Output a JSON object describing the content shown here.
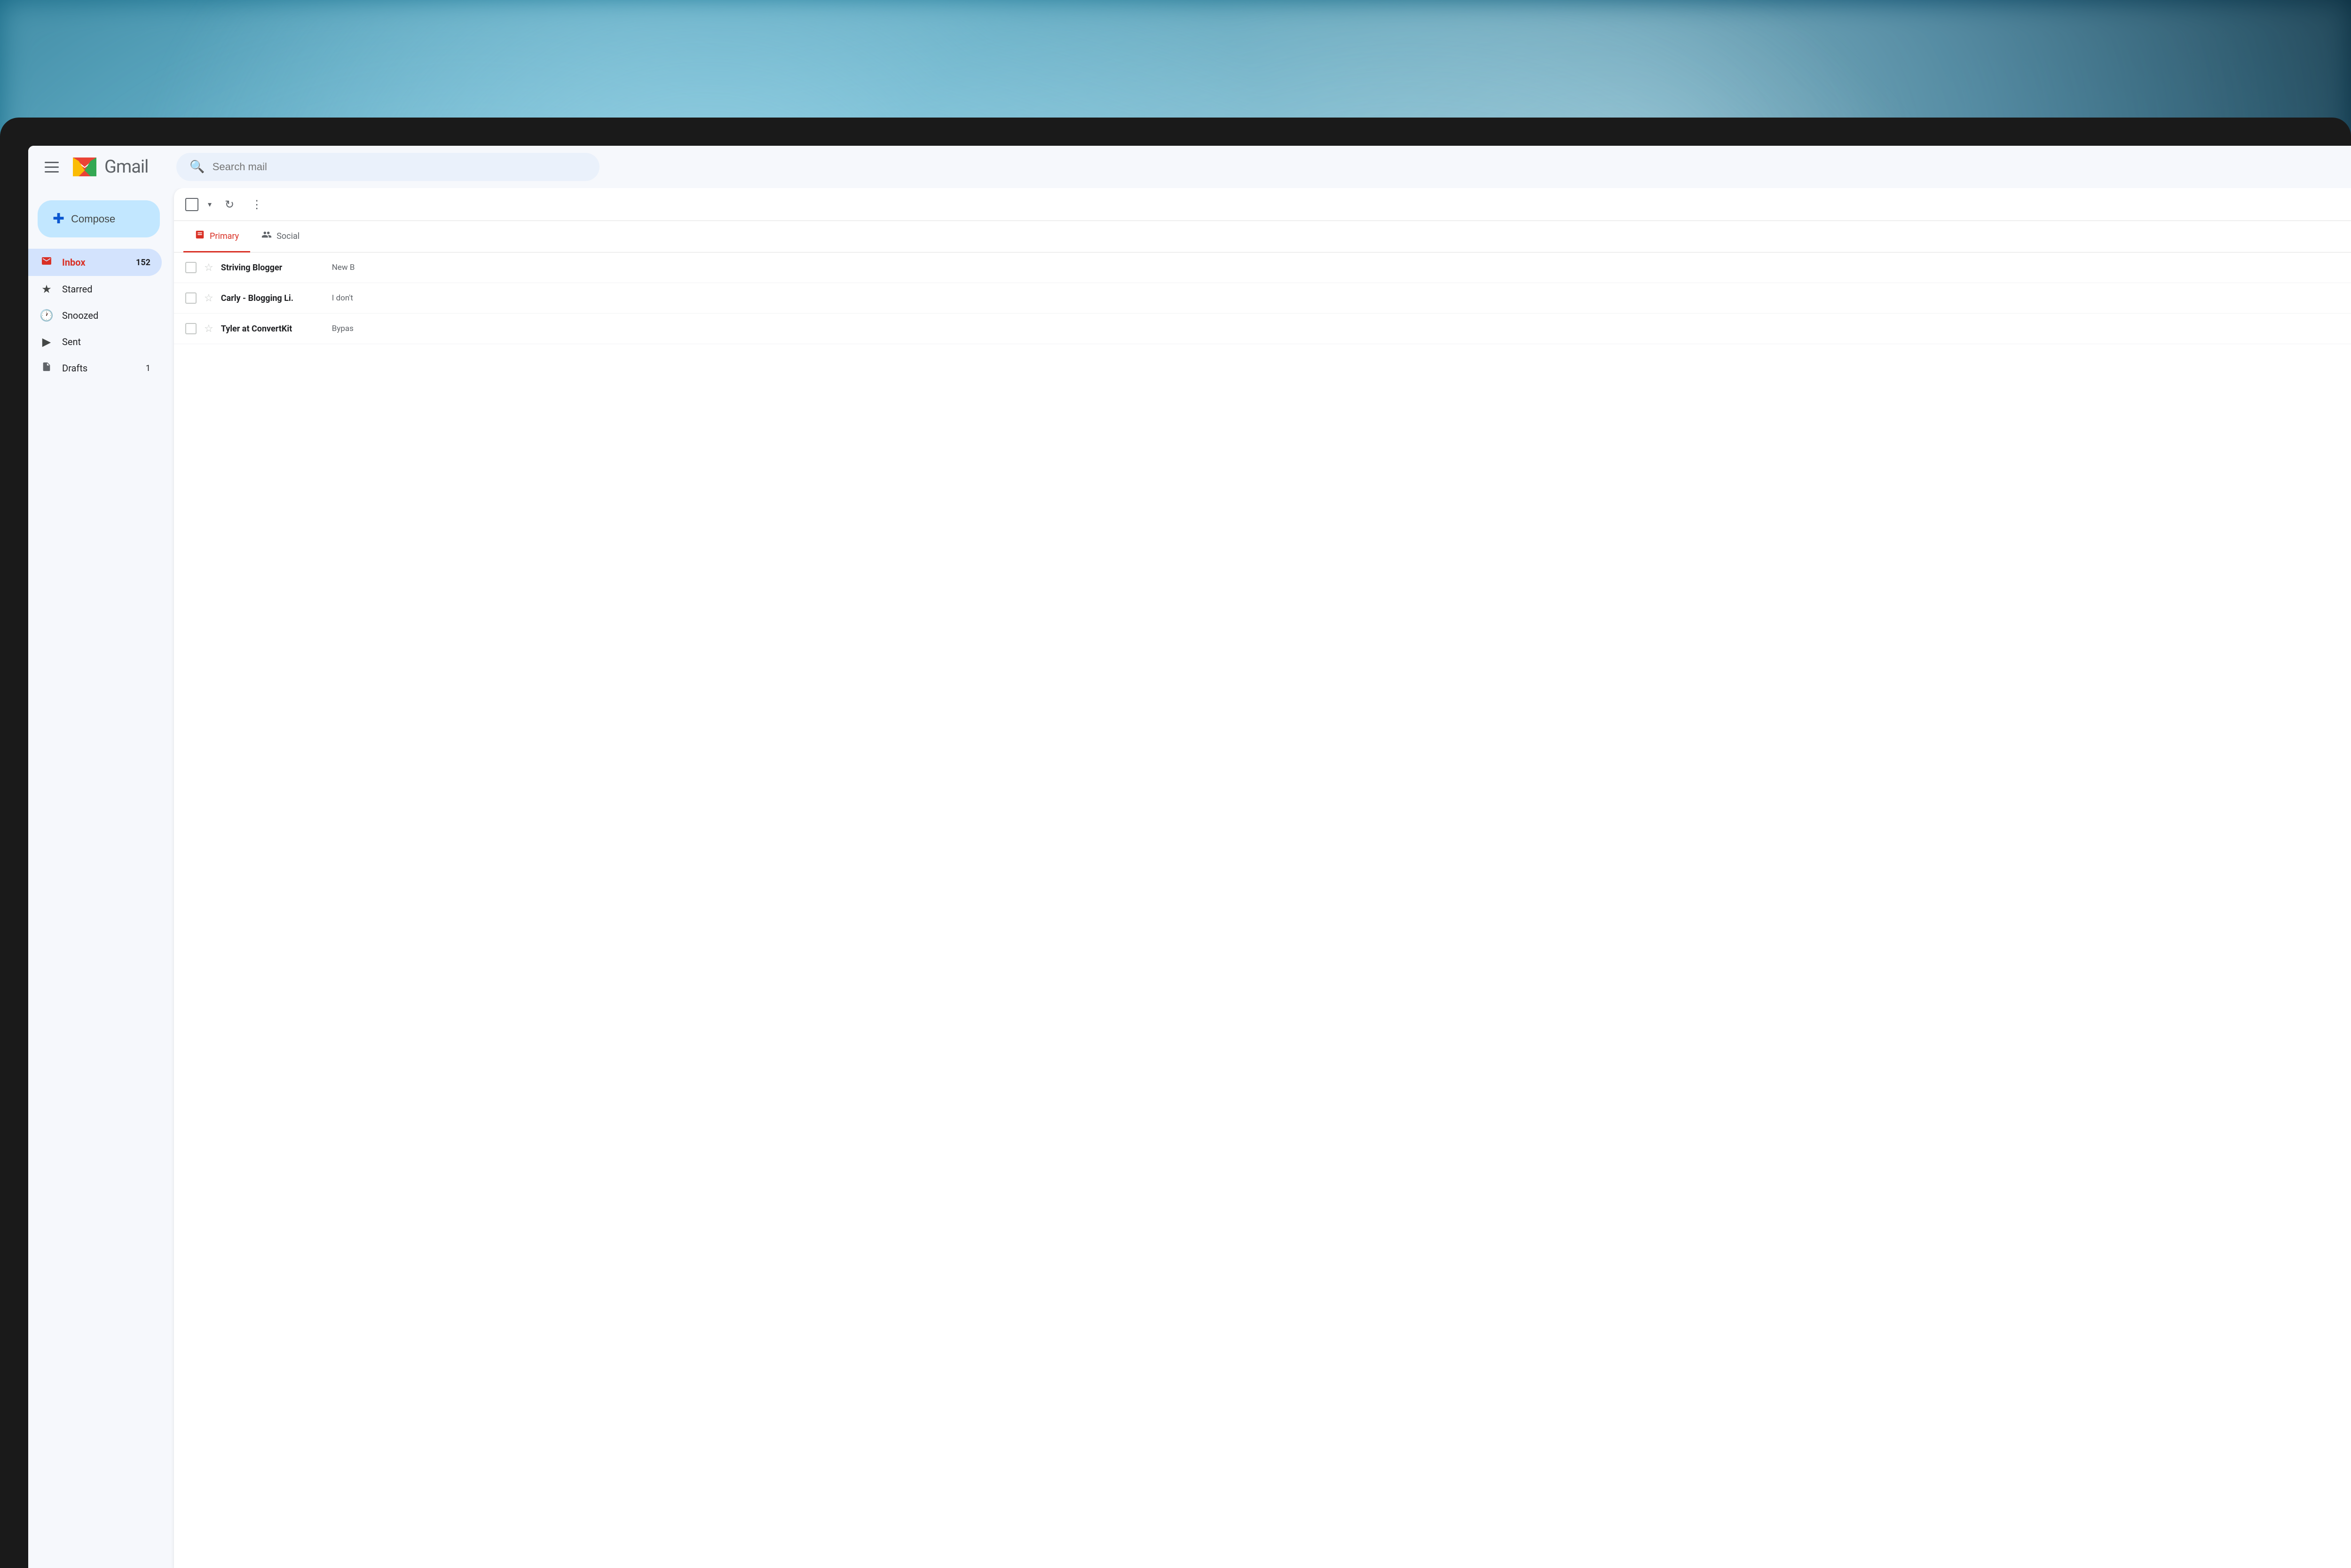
{
  "background": {
    "description": "blurred teal blue abstract background"
  },
  "header": {
    "menu_icon": "☰",
    "logo_text": "Gmail",
    "search_placeholder": "Search mail"
  },
  "sidebar": {
    "compose_label": "Compose",
    "compose_icon": "+",
    "nav_items": [
      {
        "id": "inbox",
        "label": "Inbox",
        "badge": "152",
        "active": true
      },
      {
        "id": "starred",
        "label": "Starred",
        "badge": "",
        "active": false
      },
      {
        "id": "snoozed",
        "label": "Snoozed",
        "badge": "",
        "active": false
      },
      {
        "id": "sent",
        "label": "Sent",
        "badge": "",
        "active": false
      },
      {
        "id": "drafts",
        "label": "Drafts",
        "badge": "1",
        "active": false
      }
    ]
  },
  "email_panel": {
    "toolbar": {
      "refresh_icon": "↻",
      "more_icon": "⋮"
    },
    "tabs": [
      {
        "id": "primary",
        "label": "Primary",
        "active": true
      },
      {
        "id": "social",
        "label": "Social",
        "active": false
      }
    ],
    "emails": [
      {
        "sender": "Striving Blogger",
        "preview": "New B",
        "time": ""
      },
      {
        "sender": "Carly - Blogging Li.",
        "preview": "I don't",
        "time": ""
      },
      {
        "sender": "Tyler at ConvertKit",
        "preview": "Bypas",
        "time": ""
      }
    ]
  }
}
